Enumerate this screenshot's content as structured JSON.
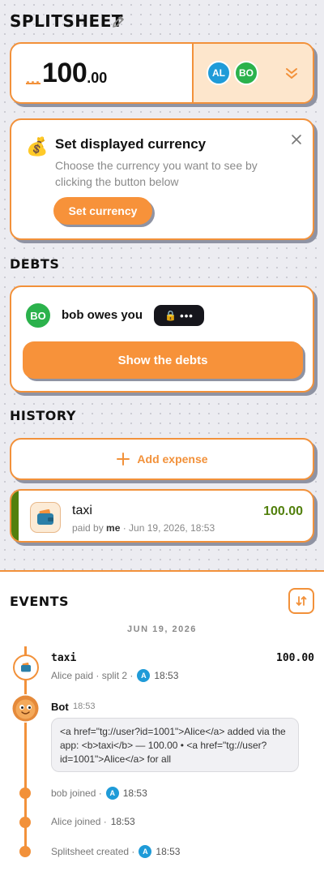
{
  "header": {
    "title": "SPLITSHEET",
    "total_hidden_marker": "...",
    "total_integer": "100",
    "total_decimal": ".00",
    "participants": [
      {
        "initials": "AL",
        "color": "#1f9bd8"
      },
      {
        "initials": "BO",
        "color": "#2bb24c"
      }
    ]
  },
  "currency_prompt": {
    "title": "Set displayed currency",
    "description": "Choose the currency you want to see by clicking the button below",
    "button_label": "Set currency"
  },
  "debts": {
    "heading": "DEBTS",
    "debtor_initials": "BO",
    "owes_text": "bob owes you",
    "hidden_amount": "•••",
    "button_label": "Show the debts"
  },
  "history": {
    "heading": "HISTORY",
    "add_label": "Add expense",
    "expenses": [
      {
        "name": "taxi",
        "paid_by_prefix": "paid by ",
        "payer": "me",
        "date": " · Jun 19, 2026, 18:53",
        "amount": "100.00"
      }
    ]
  },
  "events": {
    "heading": "EVENTS",
    "date_separator": "JUN 19, 2026",
    "expense_event": {
      "title": "taxi",
      "amount": "100.00",
      "meta": "Alice paid · split 2 ·",
      "user_initial": "A",
      "time": "18:53"
    },
    "bot_message": {
      "author": "Bot",
      "time": "18:53",
      "text": "<a href=\"tg://user?id=1001\">Alice</a> added via the app: <b>taxi</b> — 100.00 • <a href=\"tg://user?id=1001\">Alice</a> for all"
    },
    "log": [
      {
        "text": "bob joined ·",
        "user_initial": "A",
        "time": "18:53"
      },
      {
        "text": "Alice joined ·",
        "user_initial": "",
        "time": "18:53"
      },
      {
        "text": "Splitsheet created ·",
        "user_initial": "A",
        "time": "18:53"
      }
    ]
  },
  "colors": {
    "accent": "#f2913a",
    "positive": "#52800d",
    "background": "#ececf1"
  }
}
